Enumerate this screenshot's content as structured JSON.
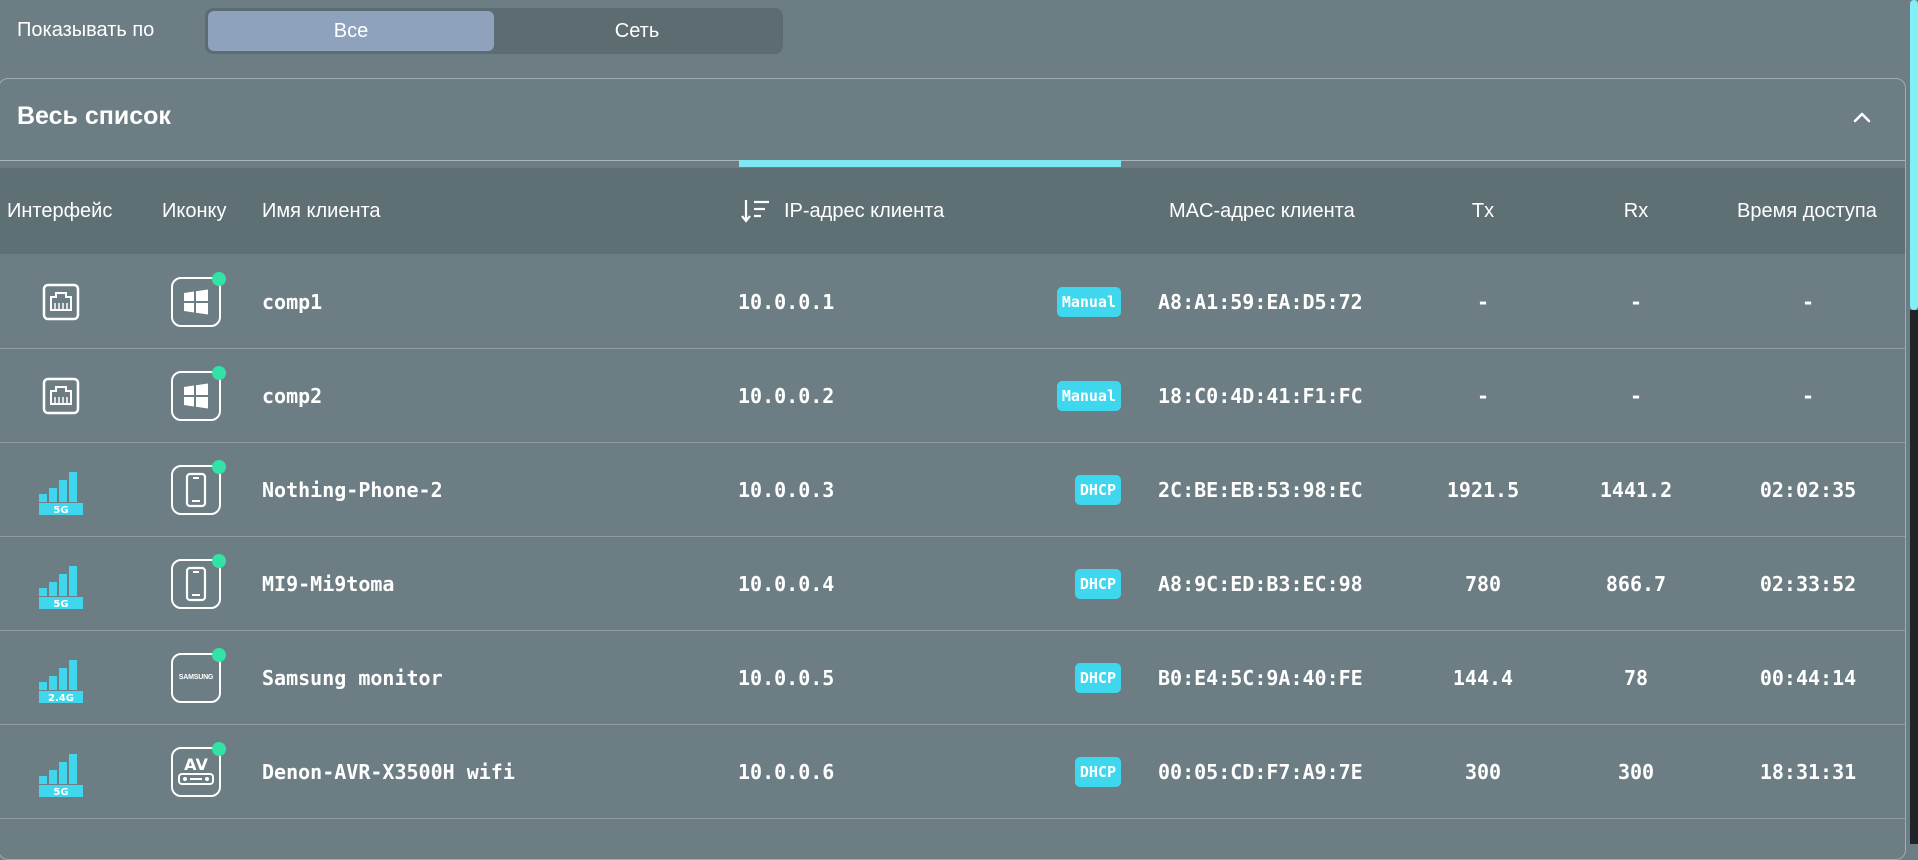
{
  "filter": {
    "label": "Показывать по",
    "options": [
      "Все",
      "Сеть"
    ],
    "selected": "Все"
  },
  "panel": {
    "title": "Весь список",
    "collapse_icon": "chevron-up-icon"
  },
  "columns": {
    "interface": "Интерфейс",
    "icon": "Иконку",
    "name": "Имя клиента",
    "ip": "IP-адрес клиента",
    "mac": "MAC-адрес клиента",
    "tx": "Tx",
    "rx": "Rx",
    "time": "Время доступа"
  },
  "colors": {
    "background": "#6c7e83",
    "header_bg": "#5f7075",
    "accent_cyan": "#3fd7ee",
    "online_green": "#33e3a6",
    "selected_segment": "#8fa2bd"
  },
  "clients": [
    {
      "interface": "ethernet-icon",
      "band": "",
      "device_icon": "windows-icon",
      "name": "comp1",
      "ip": "10.0.0.1",
      "ip_type": "Manual",
      "mac": "A8:A1:59:EA:D5:72",
      "tx": "-",
      "rx": "-",
      "time": "-"
    },
    {
      "interface": "ethernet-icon",
      "band": "",
      "device_icon": "windows-icon",
      "name": "comp2",
      "ip": "10.0.0.2",
      "ip_type": "Manual",
      "mac": "18:C0:4D:41:F1:FC",
      "tx": "-",
      "rx": "-",
      "time": "-"
    },
    {
      "interface": "wifi-signal-icon",
      "band": "5G",
      "device_icon": "phone-icon",
      "name": "Nothing-Phone-2",
      "ip": "10.0.0.3",
      "ip_type": "DHCP",
      "mac": "2C:BE:EB:53:98:EC",
      "tx": "1921.5",
      "rx": "1441.2",
      "time": "02:02:35"
    },
    {
      "interface": "wifi-signal-icon",
      "band": "5G",
      "device_icon": "phone-icon",
      "name": "MI9-Mi9toma",
      "ip": "10.0.0.4",
      "ip_type": "DHCP",
      "mac": "A8:9C:ED:B3:EC:98",
      "tx": "780",
      "rx": "866.7",
      "time": "02:33:52"
    },
    {
      "interface": "wifi-signal-icon",
      "band": "2.4G",
      "device_icon": "samsung-icon",
      "icon_text": "SAMSUNG",
      "name": "Samsung monitor",
      "ip": "10.0.0.5",
      "ip_type": "DHCP",
      "mac": "B0:E4:5C:9A:40:FE",
      "tx": "144.4",
      "rx": "78",
      "time": "00:44:14"
    },
    {
      "interface": "wifi-signal-icon",
      "band": "5G",
      "device_icon": "av-receiver-icon",
      "icon_text": "AV",
      "name": "Denon-AVR-X3500H wifi",
      "ip": "10.0.0.6",
      "ip_type": "DHCP",
      "mac": "00:05:CD:F7:A9:7E",
      "tx": "300",
      "rx": "300",
      "time": "18:31:31"
    }
  ]
}
